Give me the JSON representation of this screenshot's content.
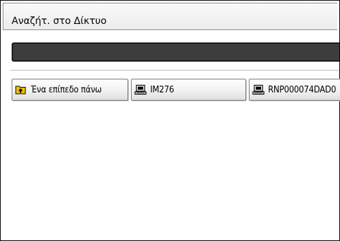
{
  "window": {
    "title": "Αναζήτ. στο Δίκτυο"
  },
  "path_field": {
    "value": ""
  },
  "buttons": {
    "up_level": {
      "label": "Ένα επίπεδο πάνω",
      "icon": "folder-up-icon"
    },
    "computer_1": {
      "label": "IM276",
      "icon": "computer-icon"
    },
    "computer_2": {
      "label": "RNP000074DAD0",
      "icon": "computer-icon"
    }
  },
  "colors": {
    "path_field_bg": "#3d3d3d",
    "folder_icon": "#f2c200"
  }
}
